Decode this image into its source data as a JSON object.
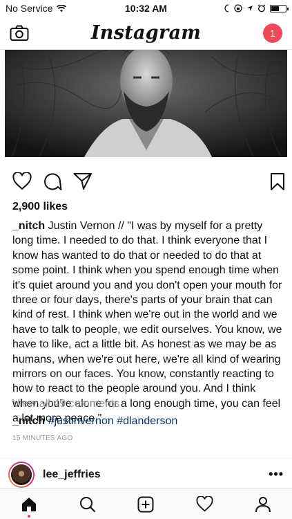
{
  "status_bar": {
    "carrier": "No Service",
    "time": "10:32 AM",
    "battery_level_percent": 60
  },
  "nav": {
    "logo": "Instagram",
    "notification_count": "1",
    "icons": [
      "camera-icon"
    ],
    "accent_color": "#ed4956"
  },
  "post": {
    "likes": "2,900 likes",
    "caption_user": "_nitch",
    "caption_text": " Justin Vernon // \"I was by myself for a pretty long time. I needed to do that. I think everyone that I know has wanted to do that or needed to do that at some point. I think when you spend enough time when it's quiet around you and you don't open your mouth for three or four days, there's parts of your brain that can kind of rest. I think when we're out in the world and we have to talk to people, we edit ourselves. You know, we have to like, act a little bit. As honest as we may be as humans, when we're out here, we're all kind of wearing mirrors on our faces. You know, constantly reacting to how to react to the people around you. And I think when you're alone for a long enough time, you can feel a lot more peace.\"",
    "view_comments": "View all 49 comments",
    "comment_user": "_nitch",
    "comment_tags": [
      "#justinvernon",
      "#dlanderson"
    ],
    "timestamp": "15 MINUTES AGO",
    "action_icons": [
      "heart-icon",
      "comment-icon",
      "share-icon",
      "bookmark-icon"
    ]
  },
  "next_post": {
    "username": "lee_jeffries",
    "more": "•••"
  },
  "tab_bar": {
    "icons": [
      "home-icon",
      "search-icon",
      "add-post-icon",
      "activity-heart-icon",
      "profile-icon"
    ]
  }
}
